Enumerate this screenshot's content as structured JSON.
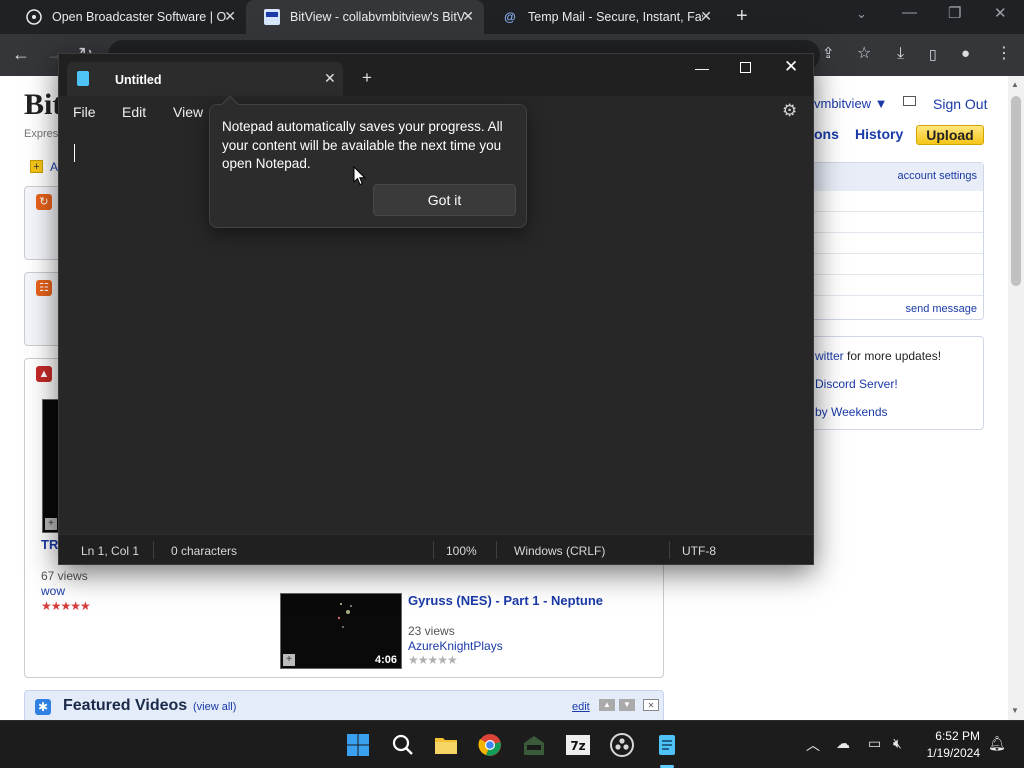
{
  "browser": {
    "tabs": [
      {
        "label": "Open Broadcaster Software | OBS",
        "active": false
      },
      {
        "label": "BitView - collabvmbitview's BitView",
        "active": true
      },
      {
        "label": "Temp Mail - Secure, Instant, Fast",
        "active": false
      }
    ],
    "close_glyph": "✕",
    "newtab_glyph": "+",
    "url": ""
  },
  "site": {
    "logo": "Bit",
    "tagline": "Expres",
    "add_label": "A",
    "username": "vmbitview ▼",
    "sign_out": "Sign Out",
    "nav_partial": "ons",
    "nav_history": "History",
    "upload": "Upload",
    "account_settings": "account settings",
    "send_message": "send message",
    "news": [
      {
        "link": "witter",
        "rest": " for more updates!"
      },
      {
        "link": "Discord Server!",
        "rest": ""
      },
      {
        "link": "by Weekends",
        "rest": ""
      }
    ],
    "left_video": {
      "title": "TR",
      "views": "67 views",
      "user": "wow",
      "stars": "★★★★★"
    },
    "video": {
      "title": "Gyruss (NES) - Part 1 - Neptune",
      "views": "23 views",
      "user": "AzureKnightPlays",
      "duration": "4:06",
      "stars": "★★★★★"
    },
    "featured": {
      "title": "Featured Videos",
      "view_all": "(view all)",
      "edit": "edit"
    }
  },
  "notepad": {
    "tab_title": "Untitled",
    "menu": [
      "File",
      "Edit",
      "View"
    ],
    "tip_text": "Notepad automatically saves your progress. All your content will be available the next time you open Notepad.",
    "tip_button": "Got it",
    "status": {
      "position": "Ln 1, Col 1",
      "chars": "0 characters",
      "zoom": "100%",
      "line_endings": "Windows (CRLF)",
      "encoding": "UTF-8"
    }
  },
  "taskbar": {
    "time": "6:52 PM",
    "date": "1/19/2024"
  },
  "colors": {
    "accent": "#60cdff",
    "link": "#1a3aa8",
    "upload": "#f5c518"
  }
}
